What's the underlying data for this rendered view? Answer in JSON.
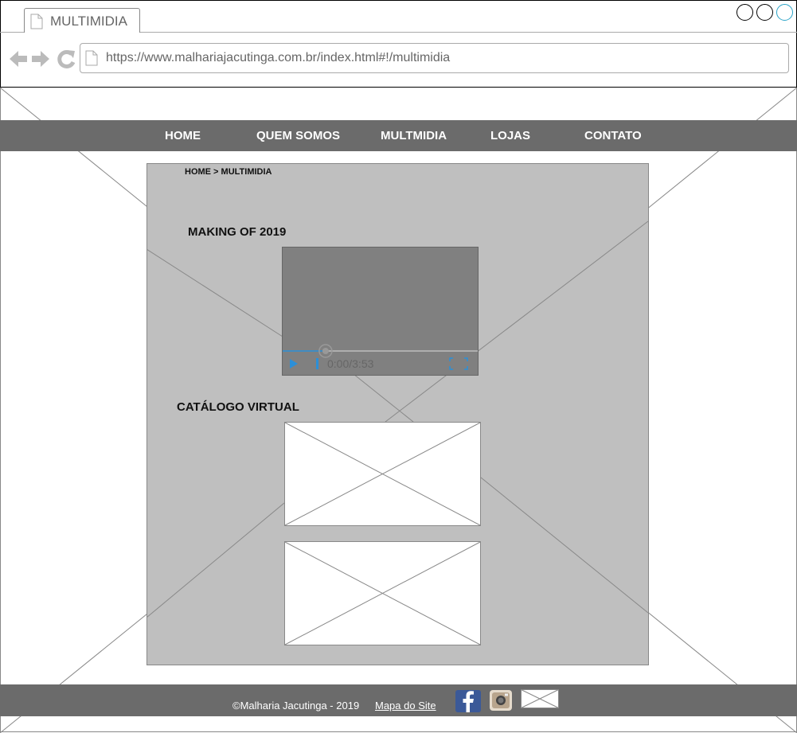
{
  "browser": {
    "tab_title": "MULTIMIDIA",
    "url": "https://www.malhariajacutinga.com.br/index.html#!/multimidia"
  },
  "nav": {
    "items": [
      {
        "label": "HOME"
      },
      {
        "label": "QUEM SOMOS"
      },
      {
        "label": "MULTMIDIA"
      },
      {
        "label": "LOJAS"
      },
      {
        "label": "CONTATO"
      }
    ]
  },
  "breadcrumb": "HOME > MULTIMIDIA",
  "sections": {
    "making_of_title": "MAKING OF 2019",
    "catalogo_title": "CATÁLOGO VIRTUAL"
  },
  "video": {
    "time": "0:00/3:53",
    "progress": 0.22
  },
  "footer": {
    "copyright": "©Malharia Jacutinga - 2019",
    "sitemap_link": "Mapa do Site"
  },
  "colors": {
    "nav_bg": "#6b6b6b",
    "panel_bg": "#bfbfbf",
    "video_bg": "#808080",
    "accent": "#2b8fd8",
    "facebook": "#3b5998"
  }
}
